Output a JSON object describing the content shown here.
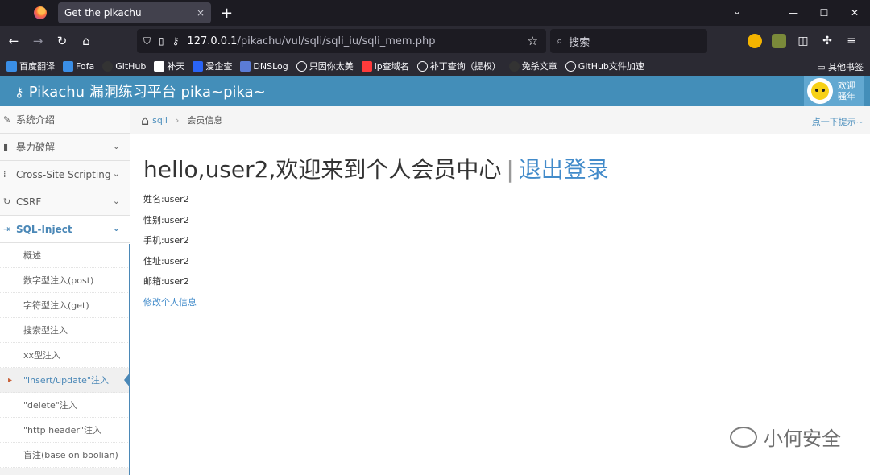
{
  "browser": {
    "tab_title": "Get the pikachu",
    "tab_close": "×",
    "new_tab": "+",
    "url_host": "127.0.0.1",
    "url_path": "/pikachu/vul/sqli/sqli_iu/sqli_mem.php",
    "search_placeholder": "搜索",
    "window_min": "—",
    "window_max": "☐",
    "window_close": "✕"
  },
  "bookmarks": {
    "items": [
      "百度翻译",
      "Fofa",
      "GitHub",
      "补天",
      "爱企查",
      "DNSLog",
      "只因你太美",
      "ip查域名",
      "补丁查询（提权）",
      "免杀文章",
      "GitHub文件加速"
    ],
    "other": "其他书签"
  },
  "app": {
    "title": "Pikachu 漏洞练习平台 pika~pika~",
    "welcome_line1": "欢迎",
    "welcome_line2": "骚年"
  },
  "sidebar": {
    "items": [
      {
        "label": "系统介绍"
      },
      {
        "label": "暴力破解"
      },
      {
        "label": "Cross-Site Scripting"
      },
      {
        "label": "CSRF"
      },
      {
        "label": "SQL-Inject"
      }
    ],
    "sub_items": [
      "概述",
      "数字型注入(post)",
      "字符型注入(get)",
      "搜索型注入",
      "xx型注入",
      "\"insert/update\"注入",
      "\"delete\"注入",
      "\"http header\"注入",
      "盲注(base on boolian)"
    ]
  },
  "breadcrumb": {
    "link": "sqli",
    "current": "会员信息",
    "hint": "点一下提示~"
  },
  "member": {
    "greeting": "hello,user2,欢迎来到个人会员中心",
    "separator": "|",
    "logout": "退出登录",
    "name": "姓名:user2",
    "gender": "性别:user2",
    "phone": "手机:user2",
    "address": "住址:user2",
    "email": "邮箱:user2",
    "edit_link": "修改个人信息"
  },
  "watermark": "小何安全"
}
